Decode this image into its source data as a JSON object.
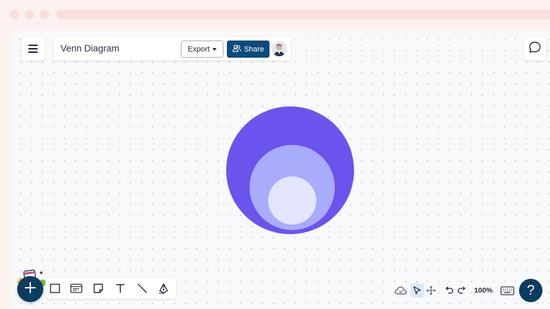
{
  "header": {
    "title": "Venn Diagram",
    "export_label": "Export",
    "share_label": "Share"
  },
  "venn": {
    "colors": [
      "#6b53ee",
      "#a8acfa",
      "#e3e6fc"
    ]
  },
  "toolbar": {
    "tools": [
      "rectangle-icon",
      "card-icon",
      "sticky-note-icon",
      "text-icon",
      "line-icon",
      "pen-icon"
    ]
  },
  "bottom_right": {
    "zoom_label": "100%",
    "help_label": "?"
  },
  "colors": {
    "brand": "#0d3c61",
    "share": "#0b4a7c",
    "canvas": "#f8f9fb"
  }
}
